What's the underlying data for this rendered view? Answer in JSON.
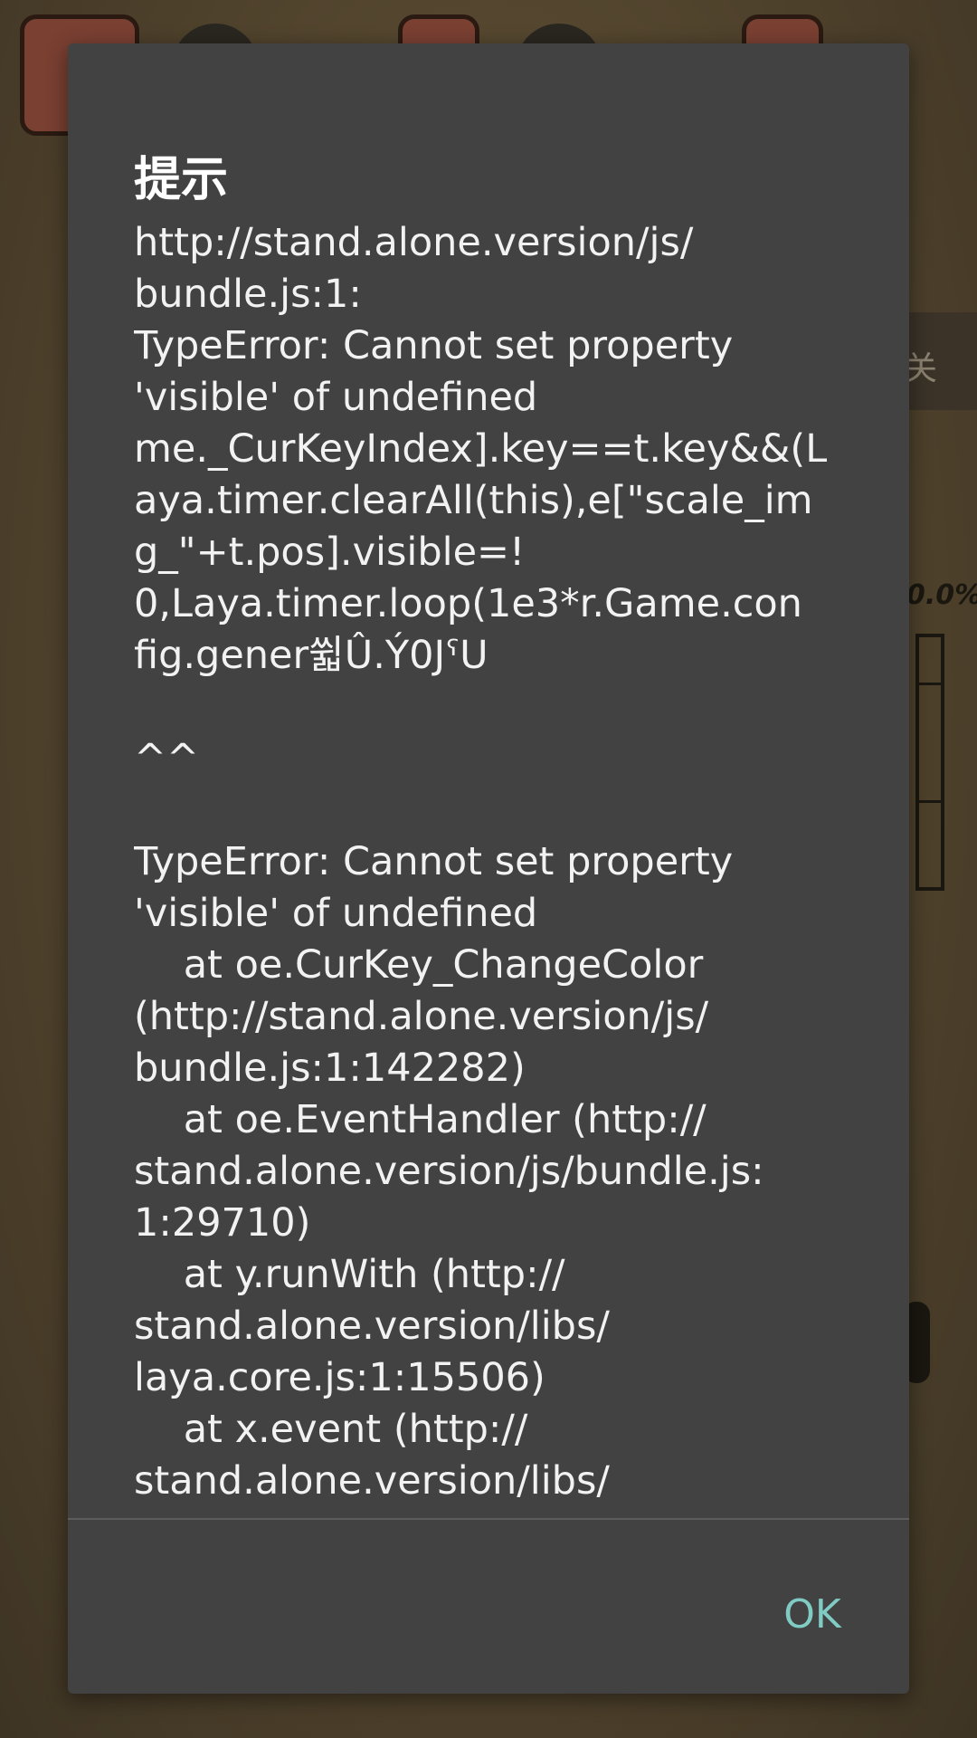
{
  "background": {
    "side_label": "关",
    "percent_label": "0.0%"
  },
  "dialog": {
    "title": "提示",
    "message": "http://stand.alone.version/js/\nbundle.js:1:\nTypeError: Cannot set property\n'visible' of undefined\nme._CurKeyIndex].key==t.key&&(L\naya.timer.clearAll(this),e[\"scale_im\ng_\"+t.pos].visible=!\n0,Laya.timer.loop(1e3*r.Game.con\nfig.gener쓃Û.Ý0JˤU\n\n^^\n\nTypeError: Cannot set property\n'visible' of undefined\n    at oe.CurKey_ChangeColor\n(http://stand.alone.version/js/\nbundle.js:1:142282)\n    at oe.EventHandler (http://\nstand.alone.version/js/bundle.js:\n1:29710)\n    at y.runWith (http://\nstand.alone.version/libs/\nlaya.core.js:1:15506)\n    at x.event (http://\nstand.alone.version/libs/",
    "ok_label": "OK"
  },
  "colors": {
    "dialog_bg": "#424242",
    "accent": "#80cbc4",
    "text": "#f2f2f2"
  }
}
